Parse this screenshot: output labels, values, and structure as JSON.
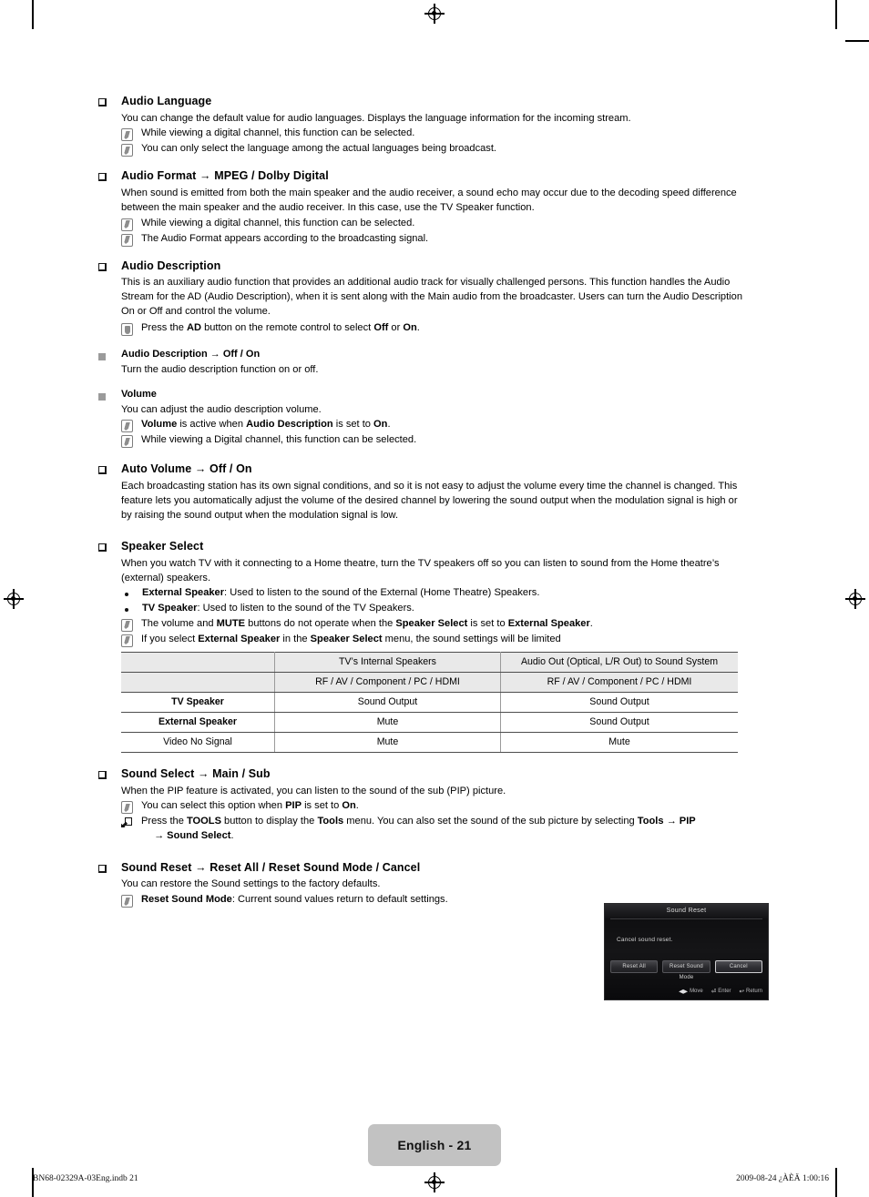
{
  "page": {
    "footer_badge": "English - 21",
    "footer_left": "BN68-02329A-03Eng.indb   21",
    "footer_right": "2009-08-24   ¿ÀÈÄ 1:00:16"
  },
  "sections": [
    {
      "id": "audio-language",
      "heading": "Audio Language",
      "body": "You can change the default value for audio languages. Displays the language information for the incoming stream.",
      "notes": [
        "While viewing a digital channel, this function can be selected.",
        "You can only select the language among the actual languages being broadcast."
      ]
    },
    {
      "id": "audio-format",
      "heading": "Audio Format → MPEG / Dolby Digital",
      "body": "When sound is emitted from both the main speaker and the audio receiver, a sound echo may occur due to the decoding speed difference between the main speaker and the audio receiver. In this case, use the TV Speaker function.",
      "notes": [
        "While viewing a digital channel, this function can be selected.",
        "The Audio Format appears according to the broadcasting signal."
      ]
    },
    {
      "id": "audio-description",
      "heading": "Audio Description",
      "body": "This is an auxiliary audio function that provides an additional audio track for visually challenged persons. This function handles the Audio Stream for the AD (Audio Description), when it is sent along with the Main audio from the broadcaster. Users can turn the Audio Description On or Off and control the volume.",
      "remote_note": "Press the AD button on the remote control to select Off or On."
    },
    {
      "id": "audio-description-sub",
      "heading": "Audio Description → Off / On",
      "body": "Turn the audio description function on or off."
    },
    {
      "id": "volume-sub",
      "heading": "Volume",
      "body": "You can adjust the audio description volume.",
      "notes": [
        "Volume is active when Audio Description is set to On.",
        "While viewing a Digital channel, this function can be selected."
      ]
    },
    {
      "id": "auto-volume",
      "heading": "Auto Volume → Off / On",
      "body": "Each broadcasting station has its own signal conditions, and so it is not easy to adjust the volume every time the channel is changed. This feature lets you automatically adjust the volume of the desired channel by lowering the sound output when the modulation signal is high or by raising the sound output when the modulation signal is low."
    },
    {
      "id": "speaker-select",
      "heading": "Speaker Select",
      "body": "When you watch TV with it connecting to a Home theatre, turn the TV speakers off so you can listen to sound from the Home theatre’s (external) speakers.",
      "dots": [
        "External Speaker: Used to listen to the sound of the External (Home Theatre) Speakers.",
        "TV Speaker: Used to listen to the sound of the TV Speakers."
      ],
      "notes": [
        "The volume and MUTE buttons do not operate when the Speaker Select is set to External Speaker.",
        "If you select External Speaker in the Speaker Select menu, the sound settings will be limited"
      ]
    },
    {
      "id": "sound-select",
      "heading": "Sound Select → Main / Sub",
      "body": "When the PIP feature is activated, you can listen to the sound of the sub (PIP) picture.",
      "notes": [
        "You can select this option when PIP is set to On."
      ],
      "tools_note_line1": "Press the TOOLS button to display the Tools menu. You can also set the sound of the sub picture by selecting Tools → PIP",
      "tools_note_line2": "→ Sound Select."
    },
    {
      "id": "sound-reset",
      "heading": "Sound Reset → Reset All / Reset Sound Mode / Cancel",
      "body": "You can restore the Sound settings to the factory defaults.",
      "notes": [
        "Reset Sound Mode: Current sound values return to default settings."
      ]
    }
  ],
  "speaker_table": {
    "header_row_1": [
      "",
      "TV’s Internal Speakers",
      "Audio Out (Optical, L/R Out) to Sound System"
    ],
    "header_row_2": [
      "",
      "RF / AV / Component / PC / HDMI",
      "RF / AV / Component / PC / HDMI"
    ],
    "rows": [
      {
        "label": "TV Speaker",
        "bold": true,
        "cells": [
          "Sound Output",
          "Sound Output"
        ]
      },
      {
        "label": "External Speaker",
        "bold": true,
        "cells": [
          "Mute",
          "Sound Output"
        ]
      },
      {
        "label": "Video No Signal",
        "bold": false,
        "cells": [
          "Mute",
          "Mute"
        ]
      }
    ]
  },
  "osd": {
    "title": "Sound Reset",
    "message": "Cancel sound reset.",
    "buttons": [
      {
        "label": "Reset All",
        "selected": false
      },
      {
        "label": "Reset Sound Mode",
        "selected": false
      },
      {
        "label": "Cancel",
        "selected": true
      }
    ],
    "hints": [
      {
        "glyph": "◀▶",
        "label": "Move"
      },
      {
        "glyph": "⏎",
        "label": "Enter"
      },
      {
        "glyph": "↩",
        "label": "Return"
      }
    ]
  }
}
